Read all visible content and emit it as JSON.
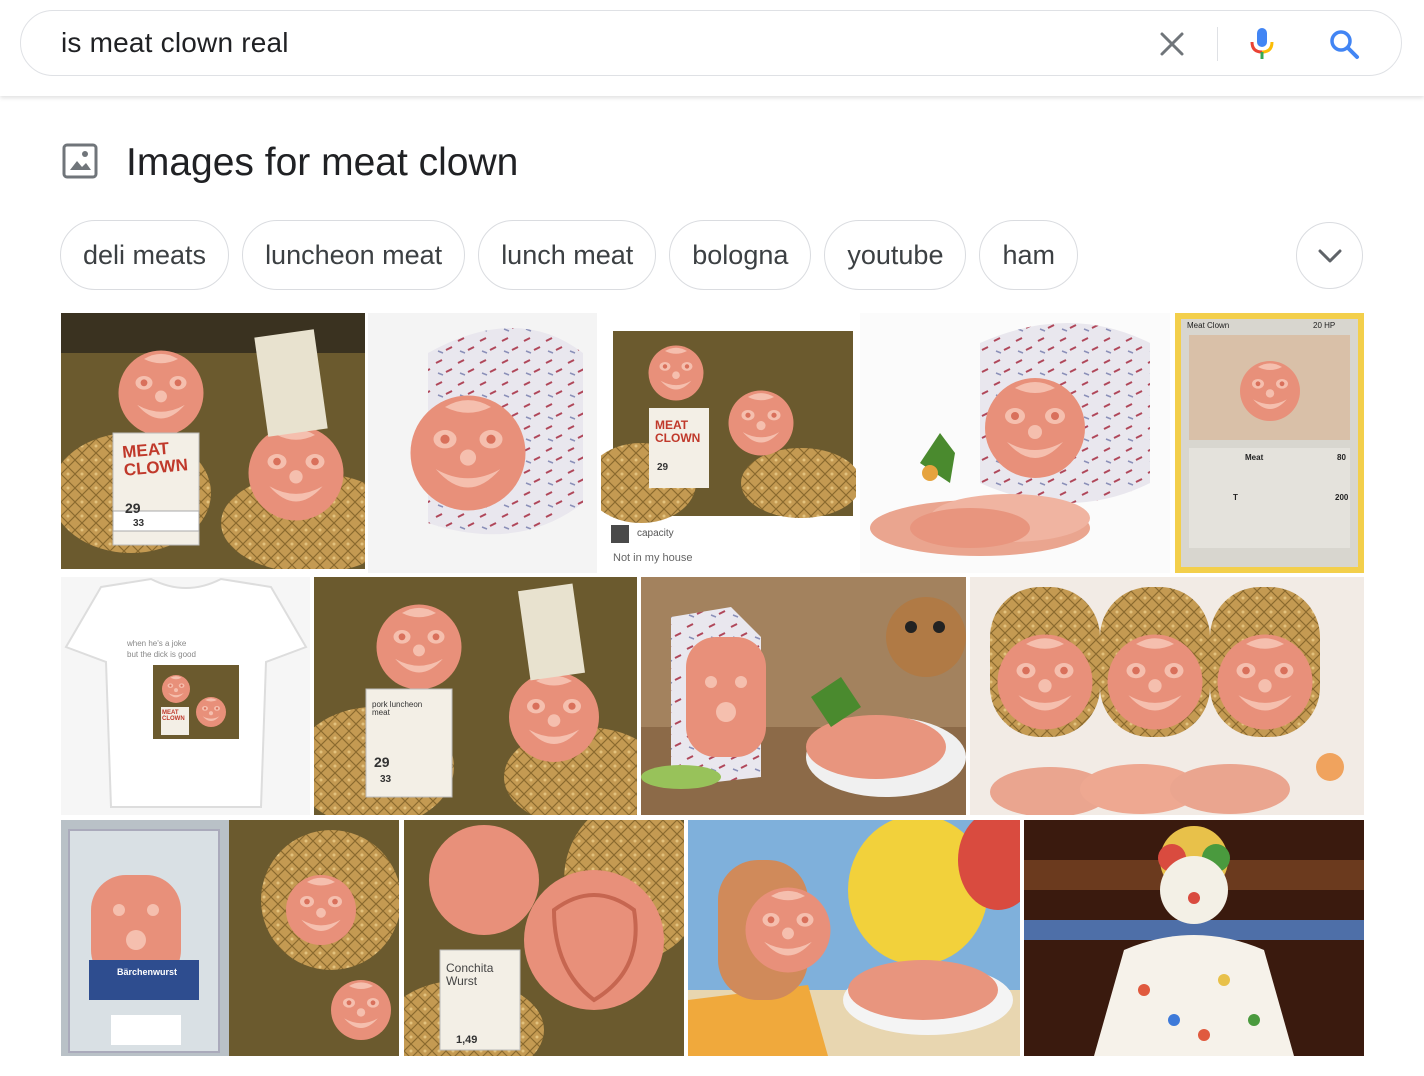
{
  "search": {
    "query": "is meat clown real",
    "clear_icon": "close-icon",
    "voice_icon": "microphone-icon",
    "search_icon": "search-icon"
  },
  "section": {
    "icon": "image-icon",
    "title": "Images for meat clown"
  },
  "chips": [
    {
      "label": "deli meats"
    },
    {
      "label": "luncheon meat"
    },
    {
      "label": "lunch meat"
    },
    {
      "label": "bologna"
    },
    {
      "label": "youtube"
    },
    {
      "label": "ham"
    }
  ],
  "chip_expand_icon": "chevron-down-icon",
  "images": {
    "img1": {
      "sign_line1": "MEAT",
      "sign_line2": "CLOWN",
      "price": "29",
      "price2": "33"
    },
    "img3": {
      "sign_line1": "MEAT",
      "sign_line2": "CLOWN",
      "price": "29",
      "user": "capacity",
      "caption": "Not in my house"
    },
    "img5": {
      "card_title": "Meat Clown",
      "hp": "20 HP",
      "move1": "Meat",
      "move1_dmg": "80",
      "move2": "T",
      "move2_dmg": "200"
    },
    "img6": {
      "shirt_text1": "when he's a joke",
      "shirt_text2": "but the dick is good",
      "sign_line1": "MEAT",
      "sign_line2": "CLOWN"
    },
    "img7": {
      "sign_line1": "pork luncheon",
      "sign_line2": "meat",
      "price": "29",
      "price2": "33"
    },
    "img10": {
      "package_label": "Bärchenwurst"
    },
    "img11": {
      "sign_line1": "Conchita",
      "sign_line2": "Wurst",
      "price": "1,49"
    }
  },
  "colors": {
    "meat": "#e8967f",
    "meat_light": "#f2b8a4",
    "casing_gold": "#c8a25a",
    "border": "#dadce0",
    "google_blue": "#4285f4",
    "google_red": "#ea4335",
    "google_yellow": "#fbbc05",
    "google_green": "#34a853"
  }
}
